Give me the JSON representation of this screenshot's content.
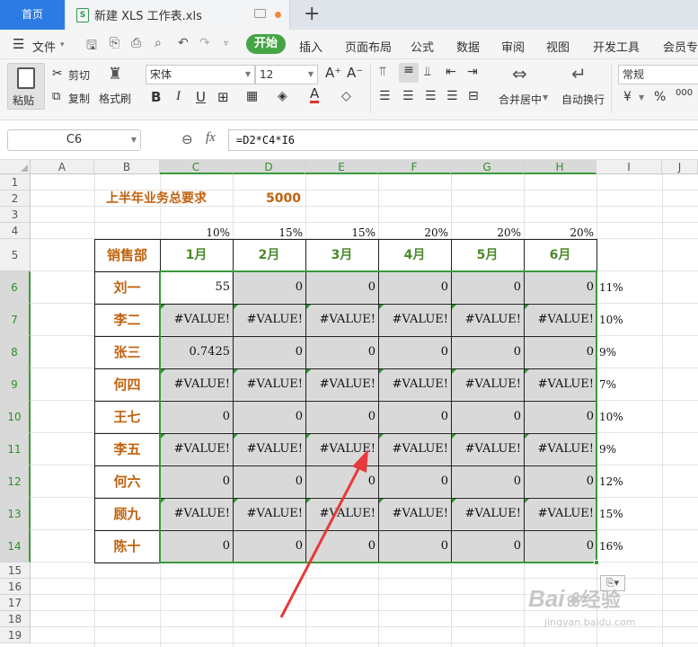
{
  "tabs": {
    "home": "首页",
    "file": "新建 XLS 工作表.xls",
    "new_tab": "+"
  },
  "menu": {
    "file": "文件",
    "start": "开始",
    "items": [
      "插入",
      "页面布局",
      "公式",
      "数据",
      "审阅",
      "视图",
      "开发工具",
      "会员专享"
    ]
  },
  "ribbon": {
    "paste": "粘贴",
    "cut": "剪切",
    "copy": "复制",
    "format_painter": "格式刷",
    "font": "宋体",
    "size": "12",
    "number_format": "常规",
    "merge": "合并居中",
    "wrap": "自动换行",
    "currency": "¥",
    "percent": "%",
    "thousands": "000"
  },
  "formula_bar": {
    "name_box": "C6",
    "fx": "fx",
    "formula": "=D2*C4*I6"
  },
  "columns": [
    "A",
    "B",
    "C",
    "D",
    "E",
    "F",
    "G",
    "H",
    "I",
    "J"
  ],
  "rows": [
    "1",
    "2",
    "3",
    "4",
    "5",
    "6",
    "7",
    "8",
    "9",
    "10",
    "11",
    "12",
    "13",
    "14",
    "15",
    "16",
    "17",
    "18",
    "19"
  ],
  "sheet": {
    "title_label": "上半年业务总要求",
    "title_value": "5000",
    "pcts": [
      "10%",
      "15%",
      "15%",
      "20%",
      "20%",
      "20%"
    ],
    "header_dept": "销售部",
    "months": [
      "1月",
      "2月",
      "3月",
      "4月",
      "5月",
      "6月"
    ],
    "names": [
      "刘一",
      "李二",
      "张三",
      "何四",
      "王七",
      "李五",
      "何六",
      "顾九",
      "陈十"
    ],
    "rates": [
      "11%",
      "10%",
      "9%",
      "7%",
      "10%",
      "9%",
      "12%",
      "15%",
      "16%"
    ],
    "values": [
      [
        "55",
        "0",
        "0",
        "0",
        "0",
        "0"
      ],
      [
        "#VALUE!",
        "#VALUE!",
        "#VALUE!",
        "#VALUE!",
        "#VALUE!",
        "#VALUE!"
      ],
      [
        "0.7425",
        "0",
        "0",
        "0",
        "0",
        "0"
      ],
      [
        "#VALUE!",
        "#VALUE!",
        "#VALUE!",
        "#VALUE!",
        "#VALUE!",
        "#VALUE!"
      ],
      [
        "0",
        "0",
        "0",
        "0",
        "0",
        "0"
      ],
      [
        "#VALUE!",
        "#VALUE!",
        "#VALUE!",
        "#VALUE!",
        "#VALUE!",
        "#VALUE!"
      ],
      [
        "0",
        "0",
        "0",
        "0",
        "0",
        "0"
      ],
      [
        "#VALUE!",
        "#VALUE!",
        "#VALUE!",
        "#VALUE!",
        "#VALUE!",
        "#VALUE!"
      ],
      [
        "0",
        "0",
        "0",
        "0",
        "0",
        "0"
      ]
    ]
  },
  "watermark": {
    "brand": "Bai",
    "brand2": "经验",
    "url": "jingyan.baidu.com"
  },
  "colors": {
    "accent": "#3a9a3a",
    "name_text": "#c0620e",
    "month_text": "#4a8a2a",
    "arrow": "#e8393c"
  }
}
